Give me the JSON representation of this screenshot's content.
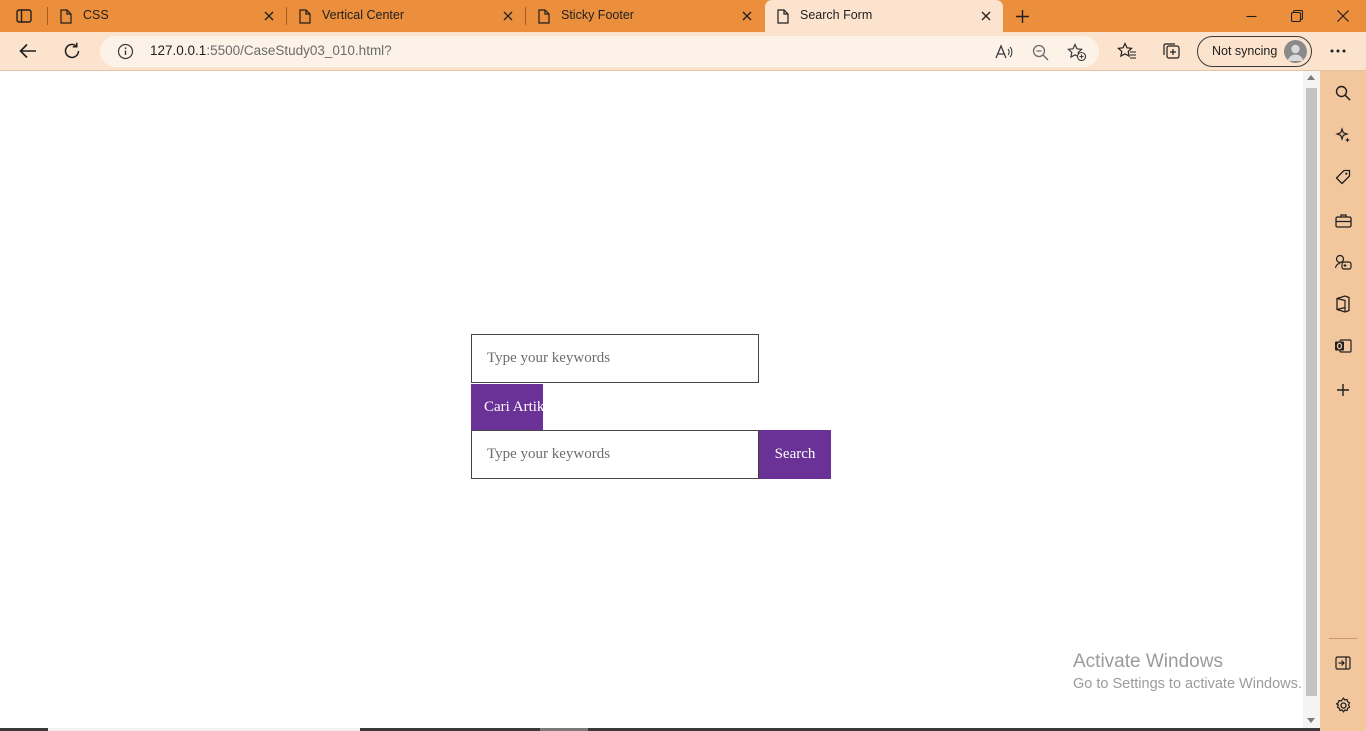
{
  "browser": {
    "tabs": [
      {
        "title": "CSS",
        "active": false
      },
      {
        "title": "Vertical Center",
        "active": false
      },
      {
        "title": "Sticky Footer",
        "active": false
      },
      {
        "title": "Search Form",
        "active": true
      }
    ],
    "address": {
      "host": "127.0.0.1",
      "rest": ":5500/CaseStudy03_010.html?"
    },
    "profile_label": "Not syncing",
    "colors": {
      "frame": "#ec8f3c",
      "toolbar": "#fbe3cd",
      "sidebar": "#f3c79e"
    }
  },
  "page": {
    "form1": {
      "placeholder": "Type your keywords",
      "button_label": "Cari Artikel"
    },
    "form2": {
      "placeholder": "Type your keywords",
      "button_label": "Search"
    },
    "accent_color": "#6a3197"
  },
  "watermark": {
    "title": "Activate Windows",
    "subtitle": "Go to Settings to activate Windows."
  }
}
